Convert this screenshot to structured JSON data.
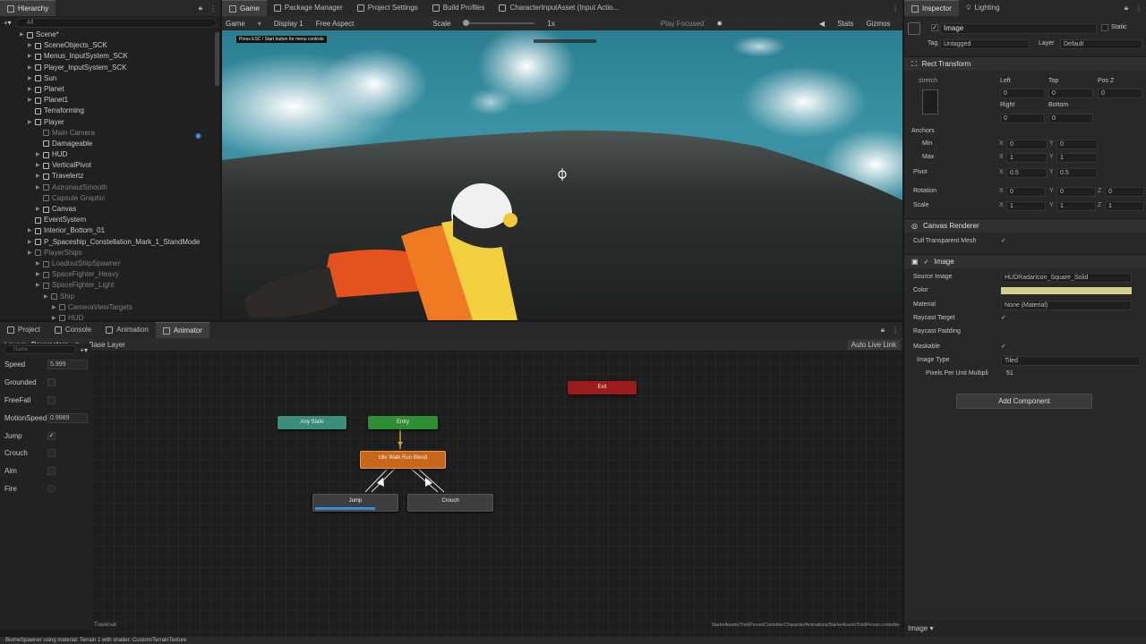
{
  "hierarchy": {
    "tab": "Hierarchy",
    "search_placeholder": "All",
    "items": [
      {
        "label": "Scene*",
        "indent": 0,
        "dim": false,
        "arrow": true
      },
      {
        "label": "SceneObjects_SCK",
        "indent": 1,
        "dim": false,
        "arrow": true
      },
      {
        "label": "Menus_InputSystem_SCK",
        "indent": 1,
        "dim": false,
        "arrow": true
      },
      {
        "label": "Player_InputSystem_SCK",
        "indent": 1,
        "dim": false,
        "arrow": true
      },
      {
        "label": "Sun",
        "indent": 1,
        "dim": false,
        "arrow": true
      },
      {
        "label": "Planet",
        "indent": 1,
        "dim": false,
        "arrow": true
      },
      {
        "label": "Planet1",
        "indent": 1,
        "dim": false,
        "arrow": true
      },
      {
        "label": "Terraforming",
        "indent": 1,
        "dim": false,
        "arrow": false
      },
      {
        "label": "Player",
        "indent": 1,
        "dim": false,
        "arrow": true
      },
      {
        "label": "Main Camera",
        "indent": 2,
        "dim": true,
        "arrow": false
      },
      {
        "label": "Damageable",
        "indent": 2,
        "dim": false,
        "arrow": false
      },
      {
        "label": "HUD",
        "indent": 2,
        "dim": false,
        "arrow": true
      },
      {
        "label": "VerticalPivot",
        "indent": 2,
        "dim": false,
        "arrow": true
      },
      {
        "label": "Travelertz",
        "indent": 2,
        "dim": false,
        "arrow": true
      },
      {
        "label": "AstronautSmooth",
        "indent": 2,
        "dim": true,
        "arrow": true
      },
      {
        "label": "Capsule Graphic",
        "indent": 2,
        "dim": true,
        "arrow": false
      },
      {
        "label": "Canvas",
        "indent": 2,
        "dim": false,
        "arrow": true
      },
      {
        "label": "EventSystem",
        "indent": 1,
        "dim": false,
        "arrow": false
      },
      {
        "label": "Interior_Bottom_01",
        "indent": 1,
        "dim": false,
        "arrow": true
      },
      {
        "label": "P_Spaceship_Constellation_Mark_1_StandMode",
        "indent": 1,
        "dim": false,
        "arrow": true
      },
      {
        "label": "PlayerShips",
        "indent": 1,
        "dim": true,
        "arrow": true
      },
      {
        "label": "LoadoutShipSpawner",
        "indent": 2,
        "dim": true,
        "arrow": true
      },
      {
        "label": "SpaceFighter_Heavy",
        "indent": 2,
        "dim": true,
        "arrow": true
      },
      {
        "label": "SpaceFighter_Light",
        "indent": 2,
        "dim": true,
        "arrow": true
      },
      {
        "label": "Ship",
        "indent": 3,
        "dim": true,
        "arrow": true
      },
      {
        "label": "CameraViewTargets",
        "indent": 4,
        "dim": true,
        "arrow": true
      },
      {
        "label": "HUD",
        "indent": 4,
        "dim": true,
        "arrow": true
      }
    ]
  },
  "top_tabs": [
    "Game",
    "Package Manager",
    "Project Settings",
    "Build Profiles",
    "CharacterInputAsset (Input Actio..."
  ],
  "game_toolbar": {
    "mode": "Game",
    "display": "Display 1",
    "aspect": "Free Aspect",
    "scale_label": "Scale",
    "scale_value": "1x",
    "play_focused": "Play Focused",
    "stats": "Stats",
    "gizmos": "Gizmos"
  },
  "game_overlay": "Press ESC / Start button for menu controls",
  "bottom_tabs": [
    "Project",
    "Console",
    "Animation",
    "Animator"
  ],
  "animator": {
    "subtabs": [
      "Layers",
      "Parameters"
    ],
    "layer": "Base Layer",
    "auto_live_link": "Auto Live Link",
    "search_placeholder": "Name",
    "params": [
      {
        "name": "Speed",
        "type": "float",
        "value": "5.999"
      },
      {
        "name": "Grounded",
        "type": "bool",
        "value": ""
      },
      {
        "name": "FreeFall",
        "type": "bool",
        "value": ""
      },
      {
        "name": "MotionSpeed",
        "type": "float",
        "value": "0.9989"
      },
      {
        "name": "Jump",
        "type": "bool",
        "value": "✓"
      },
      {
        "name": "Crouch",
        "type": "bool",
        "value": ""
      },
      {
        "name": "Aim",
        "type": "bool",
        "value": ""
      },
      {
        "name": "Fire",
        "type": "trigger",
        "value": ""
      }
    ],
    "states": {
      "exit": "Exit",
      "any": "Any State",
      "entry": "Entry",
      "blend": "Idle Walk Run Blend",
      "jump": "Jump",
      "crouch": "Crouch"
    },
    "footer_left": "Traversal",
    "footer_right": "StarterAssets/ThirdPersonController/Character/Animations/StarterAssetsThirdPerson.controller",
    "jump_progress": 0.7
  },
  "inspector": {
    "tabs": [
      "Inspector",
      "Lighting"
    ],
    "object_name": "Image",
    "static": "Static",
    "tag_label": "Tag",
    "tag": "Untagged",
    "layer_label": "Layer",
    "layer": "Default",
    "rect_transform": {
      "title": "Rect Transform",
      "stretch": "stretch",
      "left": "Left",
      "top": "Top",
      "posz": "Pos Z",
      "v_left": "0",
      "v_top": "0",
      "v_posz": "0",
      "right": "Right",
      "bottom": "Bottom",
      "v_right": "0",
      "v_bottom": "0",
      "anchors": "Anchors",
      "min": "Min",
      "max": "Max",
      "pivot": "Pivot",
      "rotation": "Rotation",
      "scale": "Scale",
      "min_x": "0",
      "min_y": "0",
      "max_x": "1",
      "max_y": "1",
      "pivot_x": "0.5",
      "pivot_y": "0.5",
      "rot_x": "0",
      "rot_y": "0",
      "rot_z": "0",
      "scale_x": "1",
      "scale_y": "1",
      "scale_z": "1"
    },
    "canvas_renderer": {
      "title": "Canvas Renderer",
      "cull": "Cull Transparent Mesh"
    },
    "image": {
      "title": "Image",
      "source_label": "Source Image",
      "source": "HUDRadarIcon_Square_Solid",
      "color_label": "Color",
      "color": "#d6cf8c",
      "material_label": "Material",
      "material": "None (Material)",
      "raycast": "Raycast Target",
      "padding": "Raycast Padding",
      "maskable": "Maskable",
      "type_label": "Image Type",
      "type": "Tiled",
      "ppu_label": "Pixels Per Unit Multipli",
      "ppu": "51"
    },
    "add_component": "Add Component",
    "preview": "Image"
  },
  "status_bar": "BiomeSpawner using material: Terrain 1 with shader: Custom/TerrainTexture"
}
